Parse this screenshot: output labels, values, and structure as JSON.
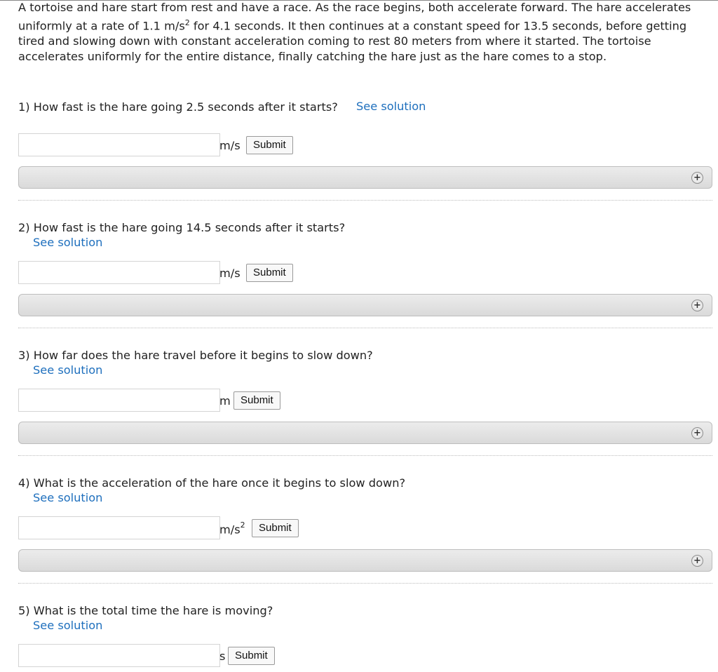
{
  "problem": {
    "text_before_sup": "A tortoise and hare start from rest and have a race. As the race begins, both accelerate forward. The hare accelerates uniformly at a rate of 1.1 m/s",
    "sup": "2",
    "text_after_sup": " for 4.1 seconds. It then continues at a constant speed for 13.5 seconds, before getting tired and slowing down with constant acceleration coming to rest 80 meters from where it started. The tortoise accelerates uniformly for the entire distance, finally catching the hare just as the hare comes to a stop."
  },
  "see_solution_label": "See solution",
  "submit_label": "Submit",
  "questions": [
    {
      "number": "1)",
      "text": "How fast is the hare going 2.5 seconds after it starts?",
      "unit": "m/s",
      "unit_sup": "",
      "input_value": ""
    },
    {
      "number": "2)",
      "text": "How fast is the hare going 14.5 seconds after it starts?",
      "unit": "m/s",
      "unit_sup": "",
      "input_value": ""
    },
    {
      "number": "3)",
      "text": "How far does the hare travel before it begins to slow down?",
      "unit": "m",
      "unit_sup": "",
      "input_value": ""
    },
    {
      "number": "4)",
      "text": "What is the acceleration of the hare once it begins to slow down?",
      "unit": "m/s",
      "unit_sup": "2",
      "input_value": ""
    },
    {
      "number": "5)",
      "text": "What is the total time the hare is moving?",
      "unit": "s",
      "unit_sup": "",
      "input_value": ""
    }
  ],
  "icons": {
    "expand": "plus-circle-icon"
  },
  "colors": {
    "link": "#1e6fbd"
  }
}
